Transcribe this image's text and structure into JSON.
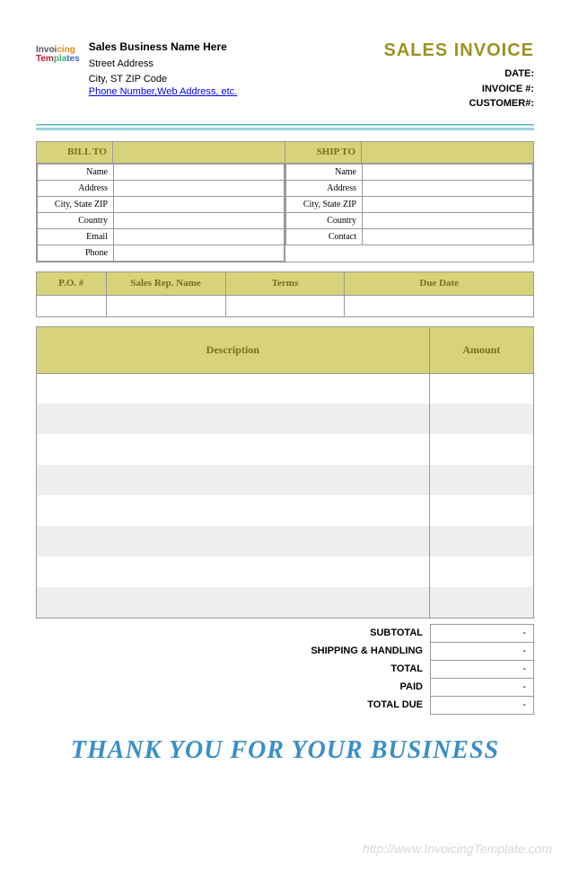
{
  "header": {
    "logo_text": "InvoicingTemplates",
    "business_name": "Sales Business Name Here",
    "street": "Street Address",
    "city_line": "City, ST  ZIP Code",
    "contact_link": "Phone Number,Web Address, etc.",
    "title": "SALES INVOICE",
    "meta": {
      "date": "DATE:",
      "invoice_no": "INVOICE #:",
      "customer_no": "CUSTOMER#:"
    }
  },
  "sections": {
    "bill_to": "BILL TO",
    "ship_to": "SHIP TO"
  },
  "bill_fields": {
    "name": "Name",
    "address": "Address",
    "csz": "City, State ZIP",
    "country": "Country",
    "email": "Email",
    "phone": "Phone"
  },
  "ship_fields": {
    "name": "Name",
    "address": "Address",
    "csz": "City, State ZIP",
    "country": "Country",
    "contact": "Contact"
  },
  "meta_cols": {
    "po": "P.O. #",
    "rep": "Sales Rep. Name",
    "terms": "Terms",
    "due": "Due Date"
  },
  "item_cols": {
    "desc": "Description",
    "amount": "Amount"
  },
  "totals": {
    "subtotal": {
      "label": "SUBTOTAL",
      "value": "-"
    },
    "shipping": {
      "label": "SHIPPING & HANDLING",
      "value": "-"
    },
    "total": {
      "label": "TOTAL",
      "value": "-"
    },
    "paid": {
      "label": "PAID",
      "value": "-"
    },
    "due": {
      "label": "TOTAL DUE",
      "value": "-"
    }
  },
  "thanks": "THANK YOU FOR YOUR BUSINESS",
  "watermark": "http://www.InvoicingTemplate.com"
}
